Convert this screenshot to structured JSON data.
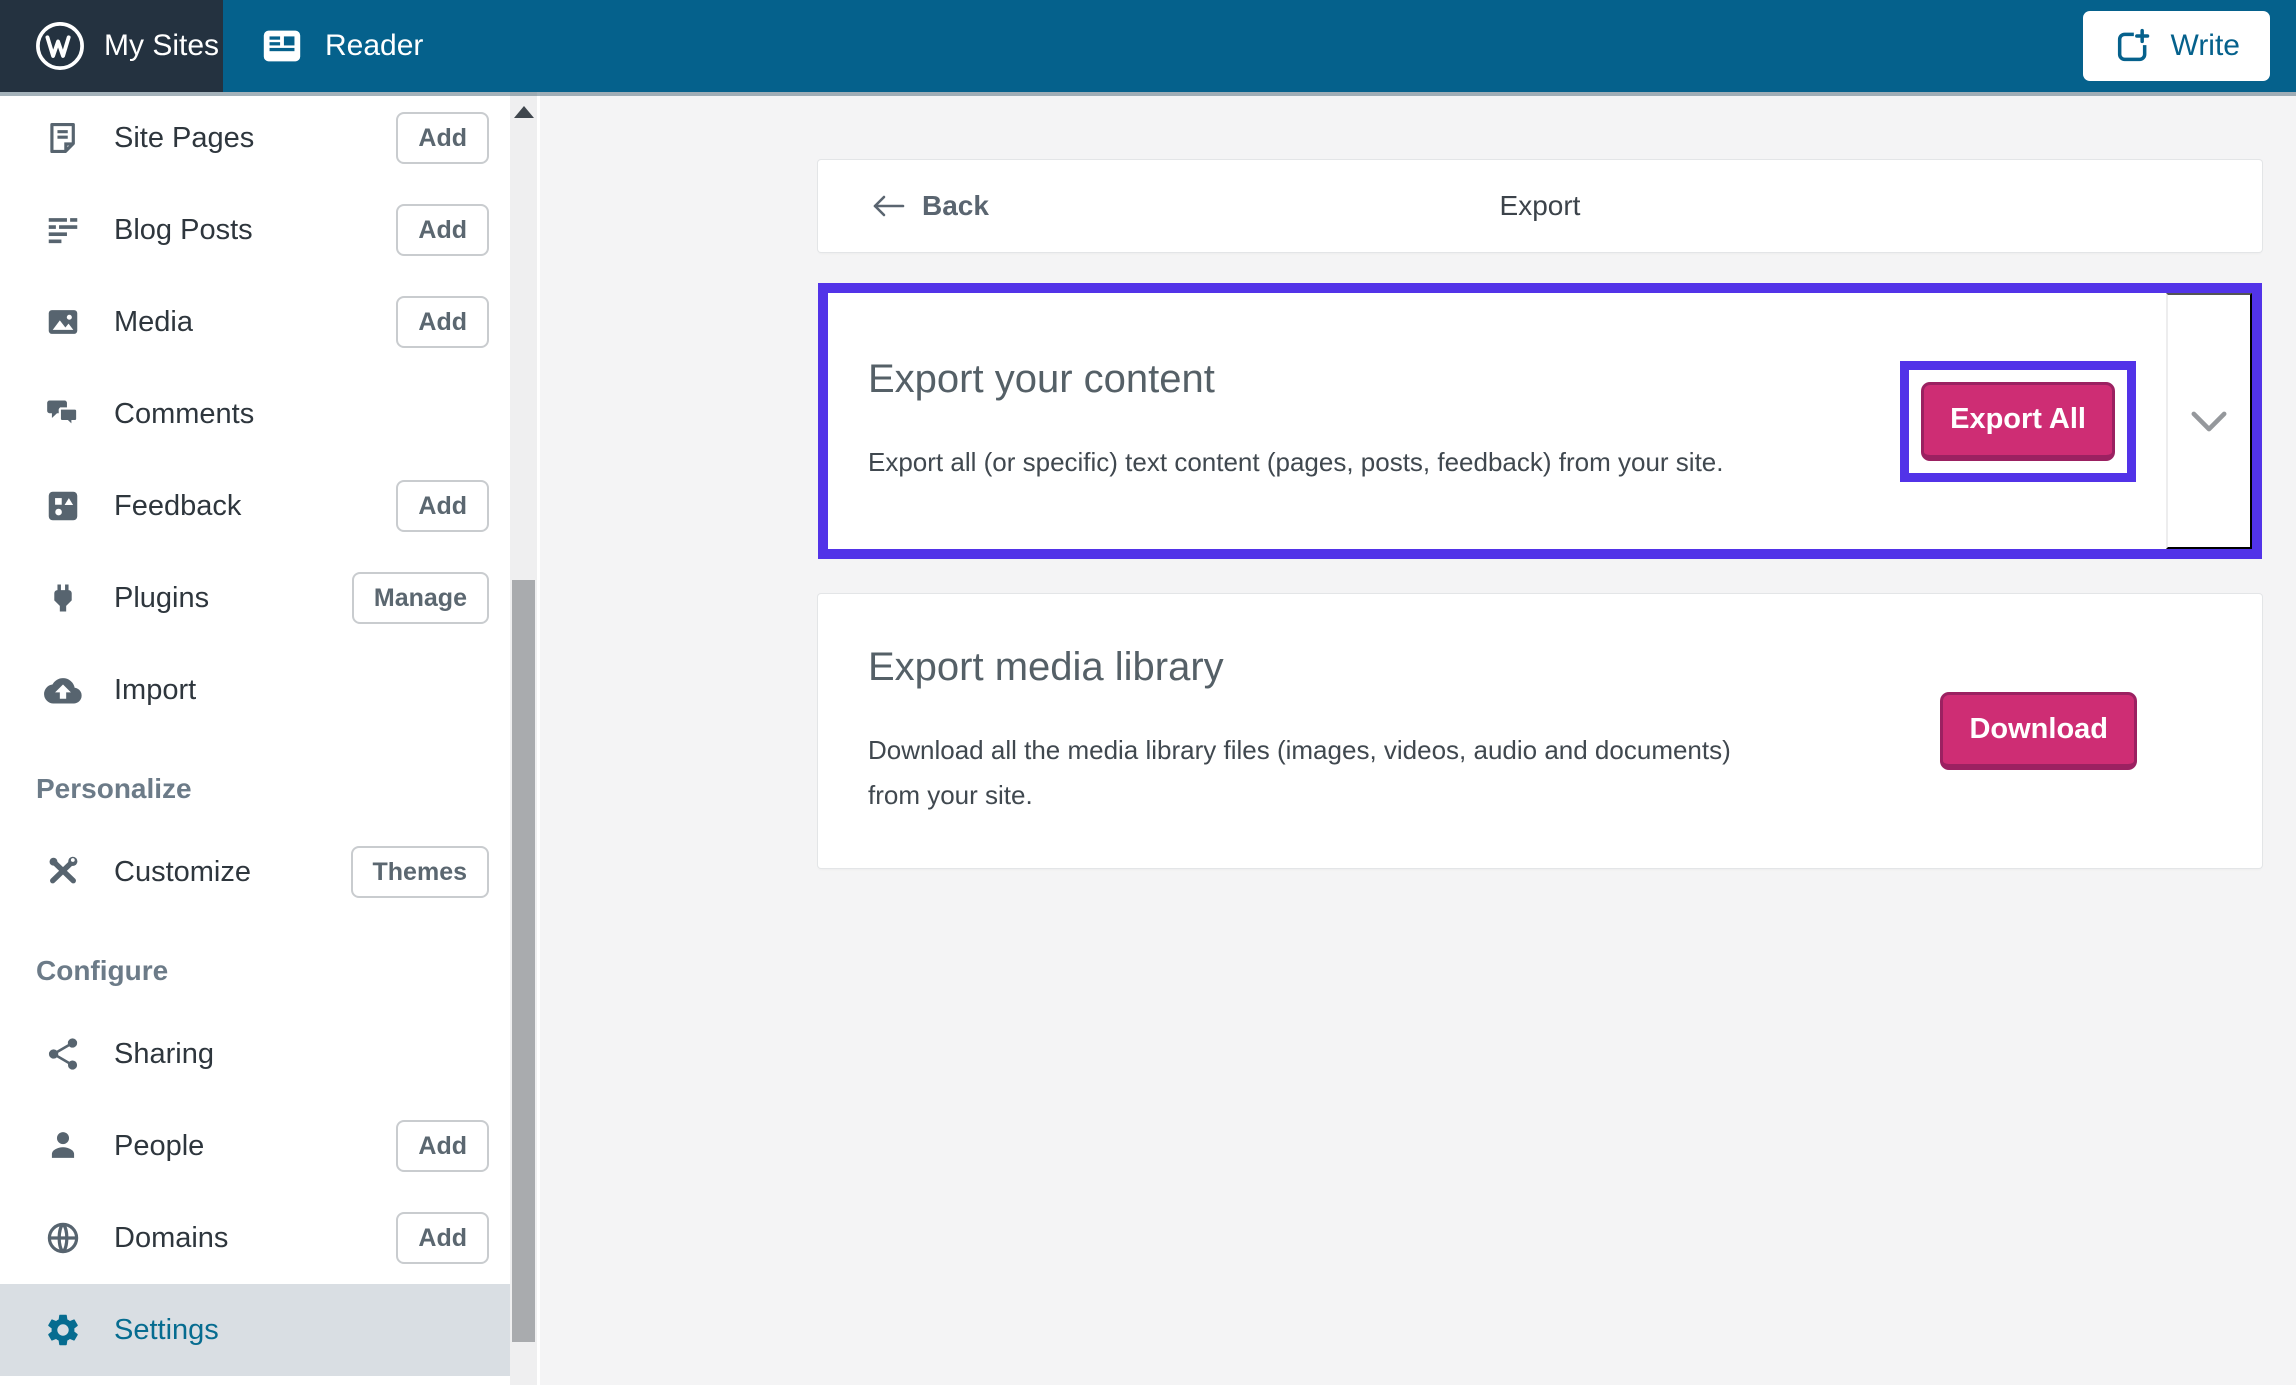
{
  "colors": {
    "masterbar_teal": "#05618c",
    "masterbar_dark": "#243240",
    "highlight_purple": "#5233e8",
    "button_pink": "#ce2d74",
    "button_pink_border": "#9b2161",
    "active_item_bg": "#d9dee3",
    "link_teal": "#066c90",
    "content_bg": "#f4f4f5"
  },
  "masterbar": {
    "my_sites": "My Sites",
    "reader": "Reader",
    "write": "Write"
  },
  "sidebar": {
    "groups": [
      {
        "header": null,
        "items": [
          {
            "label": "Site Pages",
            "action": "Add",
            "icon": "pages-icon"
          },
          {
            "label": "Blog Posts",
            "action": "Add",
            "icon": "posts-icon"
          },
          {
            "label": "Media",
            "action": "Add",
            "icon": "media-icon"
          },
          {
            "label": "Comments",
            "action": null,
            "icon": "comments-icon"
          },
          {
            "label": "Feedback",
            "action": "Add",
            "icon": "feedback-icon"
          },
          {
            "label": "Plugins",
            "action": "Manage",
            "icon": "plugin-icon"
          },
          {
            "label": "Import",
            "action": null,
            "icon": "cloud-upload-icon"
          }
        ]
      },
      {
        "header": "Personalize",
        "items": [
          {
            "label": "Customize",
            "action": "Themes",
            "icon": "customize-tools-icon"
          }
        ]
      },
      {
        "header": "Configure",
        "items": [
          {
            "label": "Sharing",
            "action": null,
            "icon": "share-icon"
          },
          {
            "label": "People",
            "action": "Add",
            "icon": "person-icon"
          },
          {
            "label": "Domains",
            "action": "Add",
            "icon": "globe-icon"
          },
          {
            "label": "Settings",
            "action": null,
            "icon": "gear-icon",
            "active": true
          }
        ]
      }
    ]
  },
  "main": {
    "back_label": "Back",
    "title": "Export",
    "cards": [
      {
        "title": "Export your content",
        "description": "Export all (or specific) text content (pages, posts, feedback) from your site.",
        "button": "Export All",
        "highlighted": true,
        "has_chevron": true
      },
      {
        "title": "Export media library",
        "description": "Download all the media library files (images, videos, audio and documents) from your site.",
        "button": "Download",
        "highlighted": false,
        "has_chevron": false
      }
    ]
  }
}
